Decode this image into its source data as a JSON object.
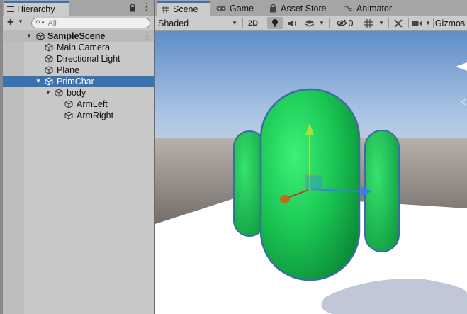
{
  "hierarchy": {
    "tab_label": "Hierarchy",
    "search_placeholder": "All",
    "items": [
      {
        "label": "SampleScene",
        "kind": "scene"
      },
      {
        "label": "Main Camera",
        "kind": "object"
      },
      {
        "label": "Directional Light",
        "kind": "object"
      },
      {
        "label": "Plane",
        "kind": "object"
      },
      {
        "label": "PrimChar",
        "kind": "object",
        "selected": true
      },
      {
        "label": "body",
        "kind": "object"
      },
      {
        "label": "ArmLeft",
        "kind": "object"
      },
      {
        "label": "ArmRight",
        "kind": "object"
      }
    ]
  },
  "scene_tabs": [
    {
      "label": "Scene",
      "icon": "grid-icon",
      "active": true
    },
    {
      "label": "Game",
      "icon": "gamepad-icon",
      "active": false
    },
    {
      "label": "Asset Store",
      "icon": "shopping-bag-icon",
      "active": false
    },
    {
      "label": "Animator",
      "icon": "animator-icon",
      "active": false
    }
  ],
  "scene_toolbar": {
    "draw_mode": "Shaded",
    "mode_2d": "2D",
    "hidden_count": "0",
    "gizmos": "Gizmos"
  },
  "colors": {
    "selection": "#3a72b0",
    "character_green": "#1fd25a",
    "sky": "#7fa3cf",
    "ground": "#ffffff",
    "gizmo_x": "#3c7cf0",
    "gizmo_y": "#a6e22e"
  }
}
